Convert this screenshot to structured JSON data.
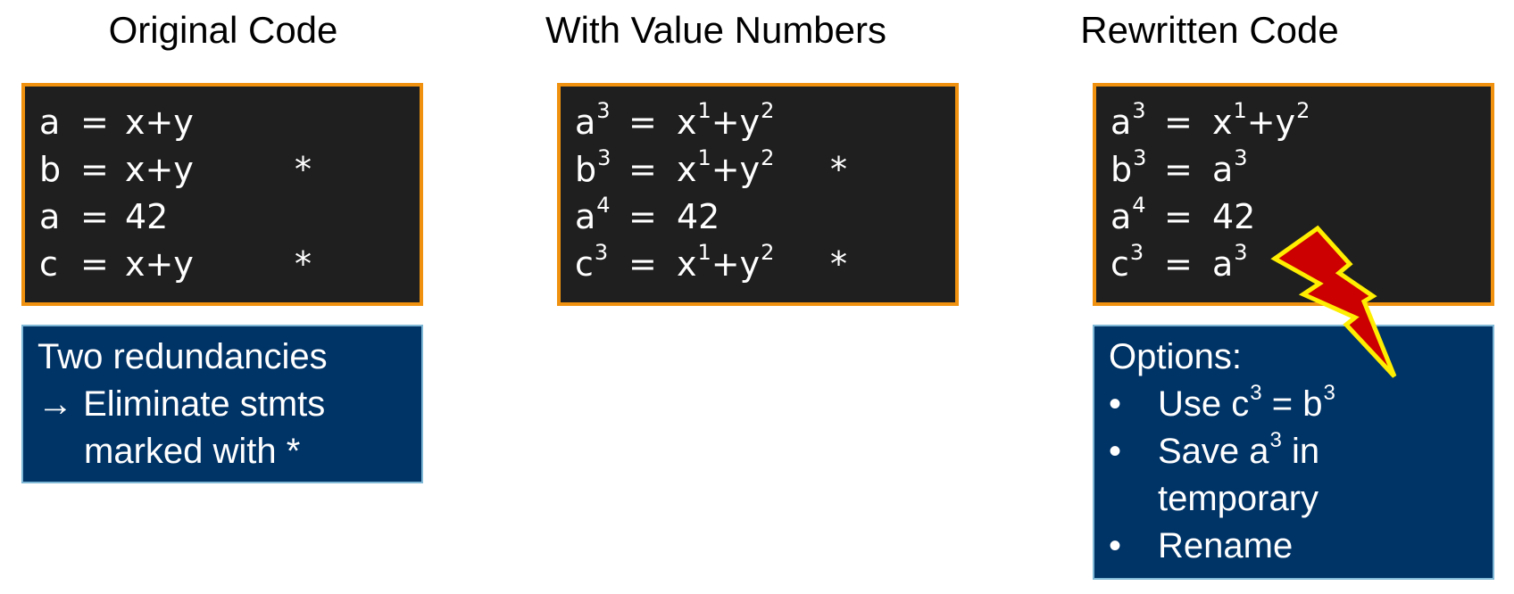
{
  "columns": {
    "original": {
      "title": "Original Code",
      "lines": [
        {
          "lhs": "a",
          "eq": "=",
          "rhs": "x+y",
          "mark": ""
        },
        {
          "lhs": "b",
          "eq": "=",
          "rhs": "x+y",
          "mark": "*"
        },
        {
          "lhs": "a",
          "eq": "=",
          "rhs": "42",
          "mark": ""
        },
        {
          "lhs": "c",
          "eq": "=",
          "rhs": "x+y",
          "mark": "*"
        }
      ],
      "note": {
        "line1": "Two redundancies",
        "arrow": "→",
        "line2": "Eliminate stmts",
        "line3": "marked with *"
      }
    },
    "value_numbers": {
      "title": "With Value Numbers",
      "lines": [
        {
          "lhs": "a",
          "lhs_sup": "3",
          "eq": "=",
          "r1": "x",
          "r1_sup": "1",
          "op": "+",
          "r2": "y",
          "r2_sup": "2",
          "mark": ""
        },
        {
          "lhs": "b",
          "lhs_sup": "3",
          "eq": "=",
          "r1": "x",
          "r1_sup": "1",
          "op": "+",
          "r2": "y",
          "r2_sup": "2",
          "mark": "*"
        },
        {
          "lhs": "a",
          "lhs_sup": "4",
          "eq": "=",
          "r1": "42",
          "r1_sup": "",
          "op": "",
          "r2": "",
          "r2_sup": "",
          "mark": ""
        },
        {
          "lhs": "c",
          "lhs_sup": "3",
          "eq": "=",
          "r1": "x",
          "r1_sup": "1",
          "op": "+",
          "r2": "y",
          "r2_sup": "2",
          "mark": "*"
        }
      ]
    },
    "rewritten": {
      "title": "Rewritten Code",
      "lines": [
        {
          "lhs": "a",
          "lhs_sup": "3",
          "eq": "=",
          "r1": "x",
          "r1_sup": "1",
          "op": "+",
          "r2": "y",
          "r2_sup": "2"
        },
        {
          "lhs": "b",
          "lhs_sup": "3",
          "eq": "=",
          "r1": "a",
          "r1_sup": "3",
          "op": "",
          "r2": "",
          "r2_sup": ""
        },
        {
          "lhs": "a",
          "lhs_sup": "4",
          "eq": "=",
          "r1": "42",
          "r1_sup": "",
          "op": "",
          "r2": "",
          "r2_sup": ""
        },
        {
          "lhs": "c",
          "lhs_sup": "3",
          "eq": "=",
          "r1": "a",
          "r1_sup": "3",
          "op": "",
          "r2": "",
          "r2_sup": ""
        }
      ],
      "note": {
        "heading": "Options:",
        "bullet": "•",
        "opt1_a": "Use c",
        "opt1_a_sup": "3",
        "opt1_b": " = b",
        "opt1_b_sup": "3",
        "opt2_a": "Save a",
        "opt2_a_sup": "3",
        "opt2_b": " in",
        "opt2_c": "temporary",
        "opt3": "Rename"
      }
    }
  },
  "colors": {
    "code_bg": "#1f1f1f",
    "code_border": "#f0920f",
    "note_bg": "#003366",
    "note_border": "#7fb8d6",
    "bolt_fill": "#cc0000",
    "bolt_stroke": "#ffee00"
  },
  "icons": {
    "conflict": "lightning-bolt-icon"
  }
}
